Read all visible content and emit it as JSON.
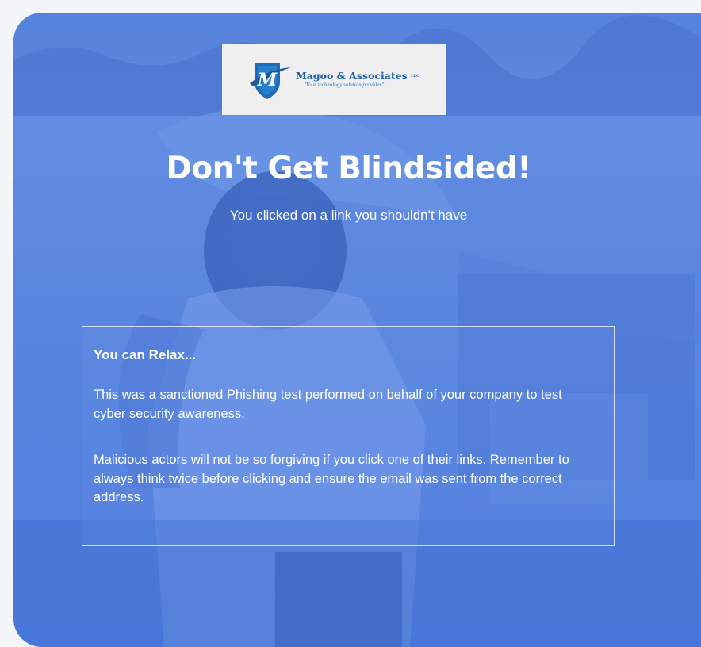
{
  "logo": {
    "name": "Magoo & Associates",
    "suffix": "LLC",
    "tagline": "\"Your technology solution provider\"",
    "monogram": "M"
  },
  "hero": {
    "title": "Don't Get Blindsided!",
    "subtitle": "You clicked on a link you shouldn't have"
  },
  "notice": {
    "heading": "You can Relax...",
    "paragraphs": [
      "This was a sanctioned Phishing test performed on behalf of your company to test cyber security awareness.",
      "Malicious actors will not be so forgiving if you click one of their links. Remember to always think twice before clicking and ensure the email was sent from the correct address."
    ]
  },
  "colors": {
    "accent": "#4a7fe0",
    "logo_blue": "#1d5fa5",
    "text": "#ffffff"
  },
  "icons": {
    "logo_shield": "shield-logo-icon"
  }
}
